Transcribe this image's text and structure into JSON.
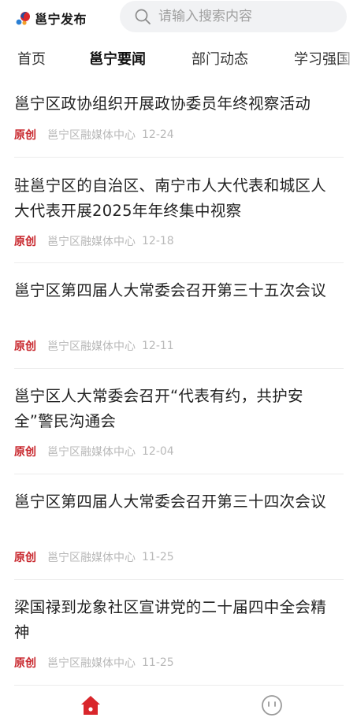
{
  "header": {
    "logo_text": "邕宁发布",
    "search_placeholder": "请输入搜索内容"
  },
  "tabs": [
    {
      "label": "首页",
      "active": false
    },
    {
      "label": "邕宁要闻",
      "active": true
    },
    {
      "label": "部门动态",
      "active": false
    },
    {
      "label": "学习强国",
      "active": false
    }
  ],
  "articles": [
    {
      "title": "邕宁区政协组织开展政协委员年终视察活动",
      "tag": "原创",
      "source": "邕宁区融媒体中心",
      "date": "12-24"
    },
    {
      "title": "驻邕宁区的自治区、南宁市人大代表和城区人大代表开展2025年年终集中视察",
      "tag": "原创",
      "source": "邕宁区融媒体中心",
      "date": "12-18"
    },
    {
      "title": "邕宁区第四届人大常委会召开第三十五次会议",
      "tag": "原创",
      "source": "邕宁区融媒体中心",
      "date": "12-11"
    },
    {
      "title": "邕宁区人大常委会召开“代表有约，共护安全”警民沟通会",
      "tag": "原创",
      "source": "邕宁区融媒体中心",
      "date": "12-04"
    },
    {
      "title": "邕宁区第四届人大常委会召开第三十四次会议",
      "tag": "原创",
      "source": "邕宁区融媒体中心",
      "date": "11-25"
    },
    {
      "title": "梁国禄到龙象社区宣讲党的二十届四中全会精神",
      "tag": "原创",
      "source": "邕宁区融媒体中心",
      "date": "11-25"
    }
  ],
  "bottom_nav": {
    "items": [
      {
        "icon": "home-icon",
        "active": true
      },
      {
        "icon": "smiley-icon",
        "active": false
      }
    ]
  },
  "colors": {
    "accent_red": "#c8262c",
    "meta_gray": "#b9b9b9",
    "search_bg": "#f1f2f4"
  }
}
